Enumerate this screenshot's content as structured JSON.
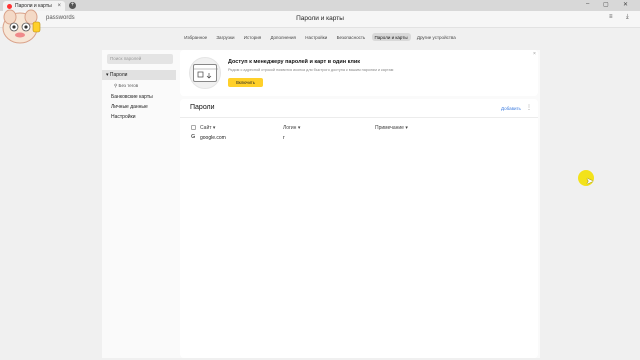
{
  "browser": {
    "tab_title": "Пароли и карты",
    "tab_close": "×",
    "new_tab": "+",
    "address_text": "passwords",
    "page_title": "Пароли и карты",
    "window_controls": [
      "–",
      "▢",
      "✕"
    ]
  },
  "nav": {
    "items": [
      "Избранное",
      "Загрузки",
      "История",
      "Дополнения",
      "Настройки",
      "Безопасность",
      "Пароли и карты",
      "Другие устройства"
    ],
    "active_index": 6
  },
  "sidebar": {
    "search_placeholder": "Поиск паролей",
    "items": [
      {
        "label": "Пароли",
        "active": true
      },
      {
        "label": "Без тегов",
        "sub": true
      },
      {
        "label": "Банковские карты"
      },
      {
        "label": "Личные данные"
      },
      {
        "label": "Настройки"
      }
    ]
  },
  "banner": {
    "title": "Доступ к менеджеру паролей и карт в один клик",
    "text": "Рядом с адресной строкой появится иконка для быстрого доступа к вашим паролям и картам",
    "button": "Включить",
    "close": "×"
  },
  "passwords": {
    "title": "Пароли",
    "add_label": "Добавить",
    "more": "⋮",
    "columns": [
      "Сайт",
      "Логин",
      "Примечание"
    ],
    "rows": [
      {
        "icon": "G",
        "site": "google.com",
        "login": "г",
        "note": ""
      }
    ]
  },
  "colors": {
    "accent_yellow": "#ffd02a",
    "link_blue": "#3b7be0",
    "cursor_highlight": "#f3e21b"
  }
}
